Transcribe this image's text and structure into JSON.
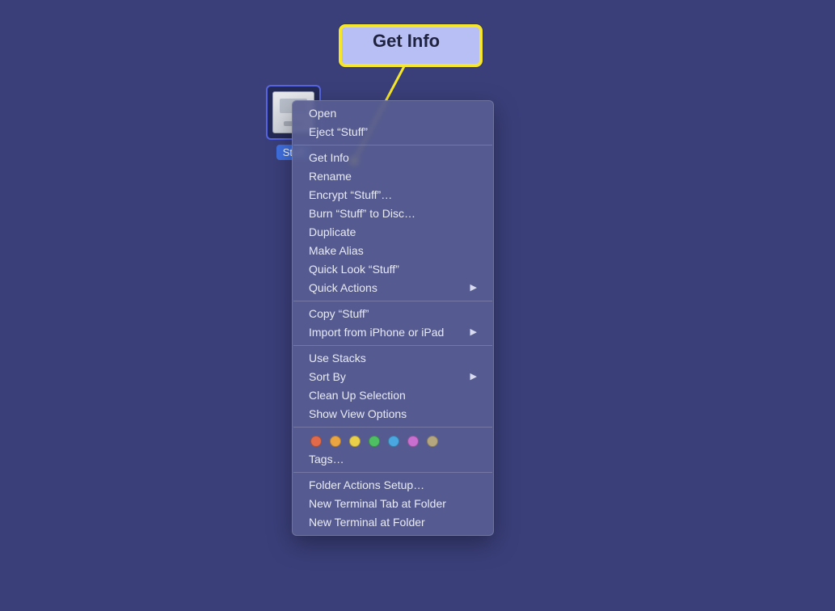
{
  "callout": {
    "label": "Get Info"
  },
  "desktop_icon": {
    "label": "Stuff"
  },
  "menu": {
    "groups": [
      {
        "items": [
          {
            "label": "Open",
            "submenu": false
          },
          {
            "label": "Eject “Stuff”",
            "submenu": false
          }
        ]
      },
      {
        "items": [
          {
            "label": "Get Info",
            "submenu": false
          },
          {
            "label": "Rename",
            "submenu": false
          },
          {
            "label": "Encrypt “Stuff”…",
            "submenu": false
          },
          {
            "label": "Burn “Stuff” to Disc…",
            "submenu": false
          },
          {
            "label": "Duplicate",
            "submenu": false
          },
          {
            "label": "Make Alias",
            "submenu": false
          },
          {
            "label": "Quick Look “Stuff”",
            "submenu": false
          },
          {
            "label": "Quick Actions",
            "submenu": true
          }
        ]
      },
      {
        "items": [
          {
            "label": "Copy “Stuff”",
            "submenu": false
          },
          {
            "label": "Import from iPhone or iPad",
            "submenu": true
          }
        ]
      },
      {
        "items": [
          {
            "label": "Use Stacks",
            "submenu": false
          },
          {
            "label": "Sort By",
            "submenu": true
          },
          {
            "label": "Clean Up Selection",
            "submenu": false
          },
          {
            "label": "Show View Options",
            "submenu": false
          }
        ]
      },
      {
        "tags": true,
        "items": [
          {
            "label": "Tags…",
            "submenu": false
          }
        ]
      },
      {
        "items": [
          {
            "label": "Folder Actions Setup…",
            "submenu": false
          },
          {
            "label": "New Terminal Tab at Folder",
            "submenu": false
          },
          {
            "label": "New Terminal at Folder",
            "submenu": false
          }
        ]
      }
    ]
  },
  "tag_colors": [
    "#e06a4a",
    "#e8a542",
    "#e9cf4a",
    "#4fbf63",
    "#4aa7e0",
    "#c96fcf",
    "#b4a77f"
  ]
}
